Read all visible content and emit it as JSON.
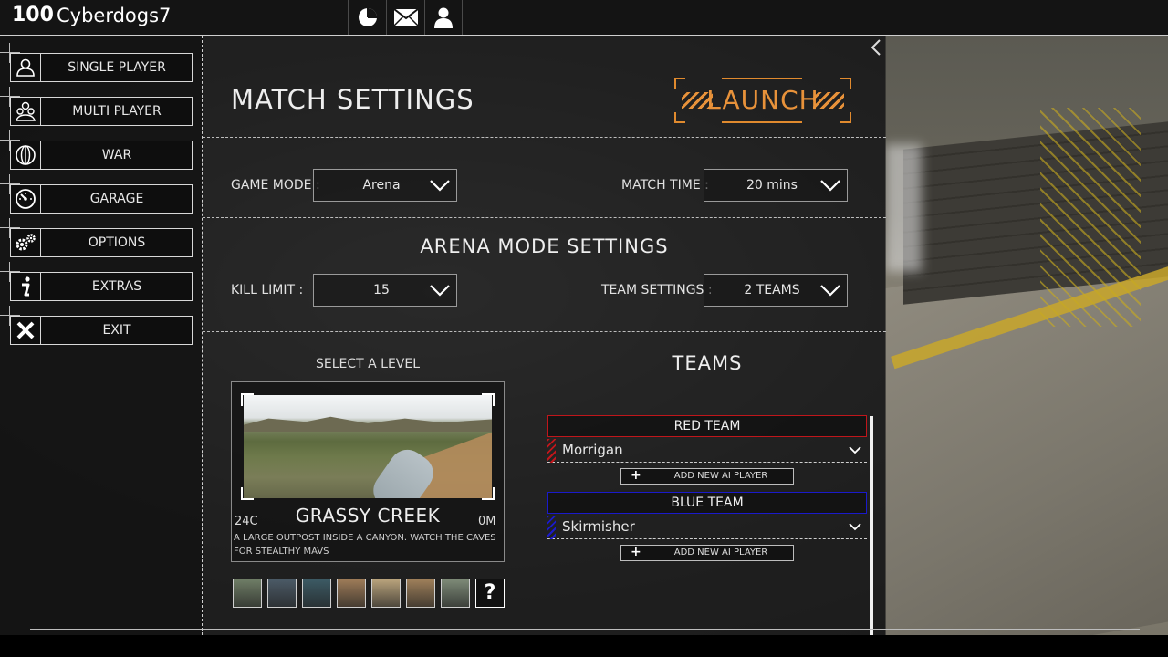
{
  "topbar": {
    "rank": "100",
    "username": "Cyberdogs7",
    "icons": [
      "stats-pie-icon",
      "mail-icon",
      "profile-icon"
    ]
  },
  "menu": {
    "items": [
      {
        "label": "SINGLE PLAYER",
        "icon": "single-player-icon"
      },
      {
        "label": "MULTI PLAYER",
        "icon": "multi-player-icon"
      },
      {
        "label": "WAR",
        "icon": "globe-icon"
      },
      {
        "label": "GARAGE",
        "icon": "gauge-icon"
      },
      {
        "label": "OPTIONS",
        "icon": "gears-icon"
      },
      {
        "label": "EXTRAS",
        "icon": "info-icon"
      },
      {
        "label": "EXIT",
        "icon": "close-icon"
      }
    ]
  },
  "match": {
    "title": "MATCH SETTINGS",
    "launch_label": "LAUNCH",
    "game_mode_label": "GAME MODE :",
    "game_mode_value": "Arena",
    "match_time_label": "MATCH TIME :",
    "match_time_value": "20 mins"
  },
  "arena": {
    "title": "ARENA MODE SETTINGS",
    "kill_limit_label": "KILL LIMIT :",
    "kill_limit_value": "15",
    "team_settings_label": "TEAM SETTINGS :",
    "team_settings_value": "2 TEAMS"
  },
  "level": {
    "select_label": "SELECT A LEVEL",
    "name": "GRASSY CREEK",
    "temperature": "24C",
    "altitude": "0M",
    "description": "A LARGE OUTPOST INSIDE A CANYON. WATCH THE CAVES FOR STEALTHY MAVS",
    "thumb_colors": [
      "#6f7d66",
      "#4b5a66",
      "#3c5a64",
      "#9d7b58",
      "#b9a37c",
      "#9e7f5a",
      "#7d8a77"
    ],
    "unknown_thumb": "?"
  },
  "teams": {
    "title": "TEAMS",
    "red": {
      "label": "RED TEAM",
      "color": "#c0161b",
      "player": "Morrigan",
      "add_label": "ADD NEW AI PLAYER"
    },
    "blue": {
      "label": "BLUE TEAM",
      "color": "#1a1acb",
      "player": "Skirmisher",
      "add_label": "ADD NEW AI PLAYER"
    }
  },
  "colors": {
    "accent": "#e8923a"
  }
}
